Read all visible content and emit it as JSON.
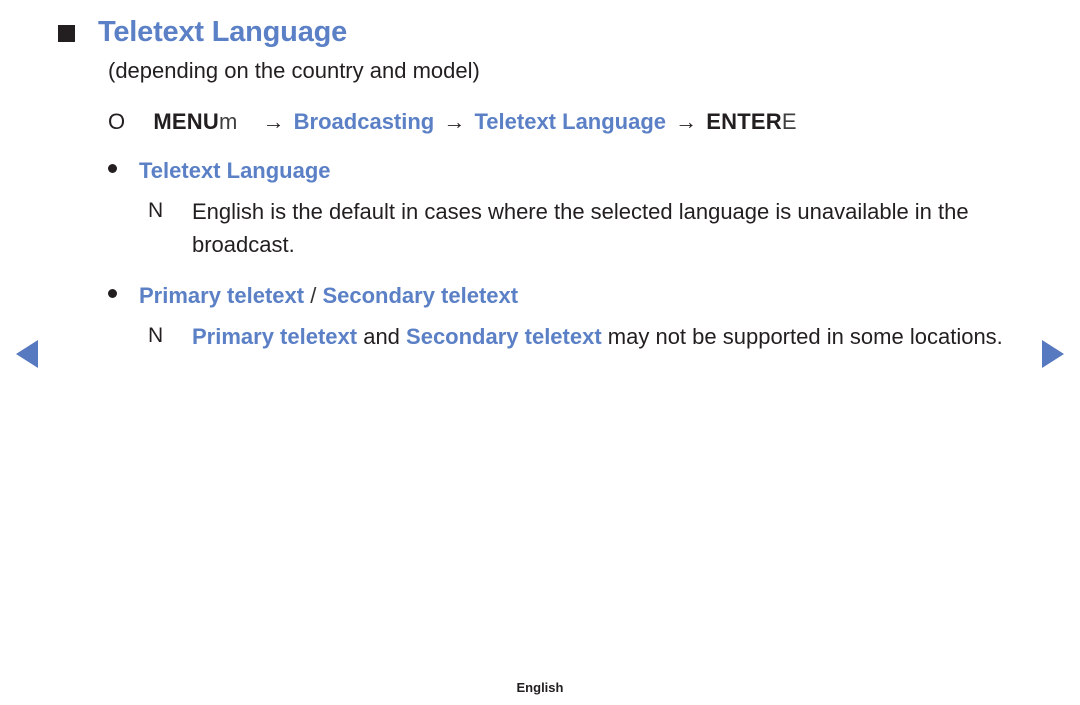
{
  "page": {
    "title": "Teletext Language",
    "subtitle": "(depending on the country and model)",
    "footer_label": "English",
    "accent_blue": "#5b80c6",
    "text_black": "#231f20"
  },
  "nav": {
    "prev_icon": "triangle-left-icon",
    "next_icon": "triangle-right-icon"
  },
  "menu_path": {
    "circle_marker": "O",
    "key_label": "MENU",
    "key_icon_char": "m",
    "arrow": "→",
    "step1": "Broadcasting",
    "step2": "Teletext Language",
    "enter_label": "ENTER",
    "enter_icon_char": "E"
  },
  "sections": [
    {
      "bullet_label": "Teletext Language",
      "bullet_label_parts": [
        {
          "text": "Teletext Language",
          "style": "highlight"
        }
      ],
      "notes": [
        {
          "marker": "N",
          "parts": [
            {
              "text": "English is the default in cases where the selected language is unavailable in the broadcast.",
              "style": "plain"
            }
          ]
        }
      ]
    },
    {
      "bullet_label": "Primary teletext / Secondary teletext",
      "bullet_label_parts": [
        {
          "text": "Primary teletext",
          "style": "highlight"
        },
        {
          "text": " / ",
          "style": "separator"
        },
        {
          "text": "Secondary teletext",
          "style": "highlight"
        }
      ],
      "notes": [
        {
          "marker": "N",
          "parts": [
            {
              "text": "Primary teletext",
              "style": "highlight"
            },
            {
              "text": " and ",
              "style": "plain"
            },
            {
              "text": "Secondary teletext",
              "style": "highlight"
            },
            {
              "text": " may not be supported in some locations.",
              "style": "plain"
            }
          ]
        }
      ]
    }
  ]
}
